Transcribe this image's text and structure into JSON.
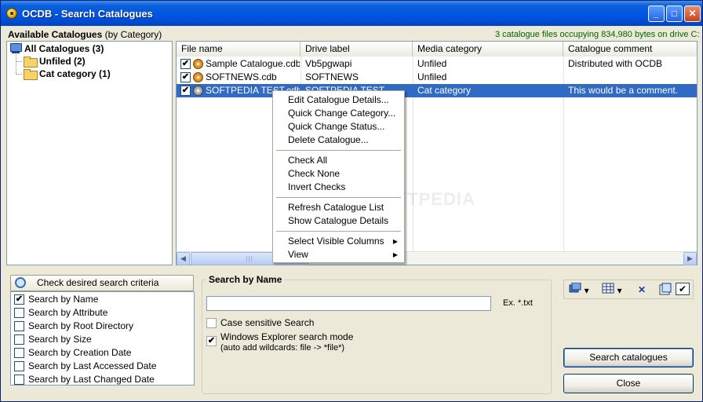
{
  "window": {
    "title": "OCDB - Search Catalogues",
    "buttons": {
      "minimize": "_",
      "maximize": "□",
      "close": "✕"
    }
  },
  "catalogues": {
    "heading": "Available Catalogues",
    "heading_suffix": "(by Category)",
    "summary": "3 catalogue files occupying 834,980 bytes on drive C:"
  },
  "tree": {
    "root": "All Catalogues (3)",
    "children": [
      "Unfiled (2)",
      "Cat category (1)"
    ]
  },
  "list": {
    "columns": [
      "File name",
      "Drive label",
      "Media category",
      "Catalogue comment"
    ],
    "rows": [
      {
        "file": "Sample Catalogue.cdb",
        "drive": "Vb5pgwapi",
        "category": "Unfiled",
        "comment": "Distributed with OCDB",
        "checked": "✔"
      },
      {
        "file": "SOFTNEWS.cdb",
        "drive": "SOFTNEWS",
        "category": "Unfiled",
        "comment": "",
        "checked": "✔"
      },
      {
        "file": "SOFTPEDIA TEST.cdb",
        "drive": "SOFTPEDIA TEST",
        "category": "Cat category",
        "comment": "This would be a comment.",
        "checked": "✔"
      }
    ],
    "scroll_left": "◀",
    "scroll_right": "▶",
    "scroll_grip": "|||"
  },
  "context_menu": {
    "groups": [
      [
        "Edit Catalogue Details...",
        "Quick Change Category...",
        "Quick Change Status...",
        "Delete Catalogue..."
      ],
      [
        "Check All",
        "Check None",
        "Invert Checks"
      ],
      [
        "Refresh Catalogue List",
        "Show Catalogue Details"
      ],
      [
        "Select Visible Columns",
        "View"
      ]
    ],
    "submenu_arrow": "▶"
  },
  "criteria": {
    "header": "Check desired search criteria",
    "items": [
      {
        "label": "Search by Name",
        "checked": "✔"
      },
      {
        "label": "Search by Attribute",
        "checked": ""
      },
      {
        "label": "Search by Root Directory",
        "checked": ""
      },
      {
        "label": "Search by Size",
        "checked": ""
      },
      {
        "label": "Search by Creation Date",
        "checked": ""
      },
      {
        "label": "Search by Last Accessed Date",
        "checked": ""
      },
      {
        "label": "Search by Last Changed Date",
        "checked": ""
      }
    ]
  },
  "search_by_name": {
    "title": "Search by Name",
    "input_value": "",
    "example": "Ex.  *.txt",
    "case_sensitive": {
      "label": "Case sensitive Search",
      "checked": ""
    },
    "explorer_mode": {
      "label": "Windows Explorer search mode",
      "sublabel": "(auto add wildcards: file -> *file*)",
      "checked": "✔"
    }
  },
  "toolbar": {
    "dropdown_arrow": "▾",
    "delete": "✕",
    "check": "✔"
  },
  "actions": {
    "search": "Search catalogues",
    "close": "Close"
  },
  "watermark": "SOFTPEDIA"
}
